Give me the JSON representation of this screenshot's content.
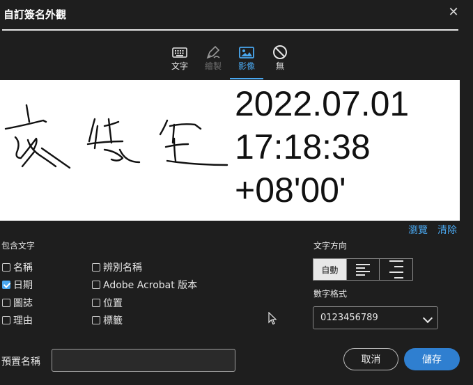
{
  "dialog": {
    "title": "自訂簽名外觀",
    "close_icon": "✕"
  },
  "tabs": [
    {
      "label": "文字",
      "icon": "keyboard-icon",
      "state": "normal"
    },
    {
      "label": "繪製",
      "icon": "pen-icon",
      "state": "disabled"
    },
    {
      "label": "影像",
      "icon": "image-icon",
      "state": "active"
    },
    {
      "label": "無",
      "icon": "none-icon",
      "state": "normal"
    }
  ],
  "preview": {
    "signature": "handwritten-signature",
    "date_lines": [
      "2022.07.01",
      "17:18:38",
      "+08'00'"
    ]
  },
  "links": {
    "browse": "瀏覽",
    "clear": "清除"
  },
  "include_text": {
    "label": "包含文字",
    "options": [
      {
        "label": "名稱",
        "checked": false
      },
      {
        "label": "日期",
        "checked": true
      },
      {
        "label": "圖誌",
        "checked": false
      },
      {
        "label": "理由",
        "checked": false
      },
      {
        "label": "辨別名稱",
        "checked": false
      },
      {
        "label": "Adobe Acrobat 版本",
        "checked": false
      },
      {
        "label": "位置",
        "checked": false
      },
      {
        "label": "標籤",
        "checked": false
      }
    ]
  },
  "text_direction": {
    "label": "文字方向",
    "options": [
      {
        "label": "自動",
        "selected": true
      },
      {
        "icon": "align-left-icon",
        "selected": false
      },
      {
        "icon": "align-right-icon",
        "selected": false
      }
    ]
  },
  "number_format": {
    "label": "數字格式",
    "value": "0123456789"
  },
  "preset": {
    "label": "預置名稱",
    "value": ""
  },
  "buttons": {
    "cancel": "取消",
    "save": "儲存"
  },
  "colors": {
    "accent": "#4aa8f0",
    "primary_button": "#2f7fd0",
    "background": "#1e1e1e"
  }
}
